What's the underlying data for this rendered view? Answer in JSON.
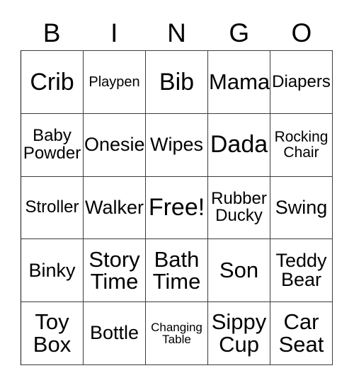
{
  "card": {
    "title": "BINGO",
    "columns": [
      "B",
      "I",
      "N",
      "G",
      "O"
    ],
    "rows": [
      [
        {
          "label": "Crib",
          "size": "xl"
        },
        {
          "label": "Playpen",
          "size": "xxs"
        },
        {
          "label": "Bib",
          "size": "xl"
        },
        {
          "label": "Mama",
          "size": "lg"
        },
        {
          "label": "Diapers",
          "size": "sm"
        }
      ],
      [
        {
          "label": "Baby\nPowder",
          "size": "sm"
        },
        {
          "label": "Onesie",
          "size": "md"
        },
        {
          "label": "Wipes",
          "size": "md"
        },
        {
          "label": "Dada",
          "size": "xl"
        },
        {
          "label": "Rocking\nChair",
          "size": "xs"
        }
      ],
      [
        {
          "label": "Stroller",
          "size": "sm"
        },
        {
          "label": "Walker",
          "size": "md"
        },
        {
          "label": "Free!",
          "size": "xl"
        },
        {
          "label": "Rubber\nDucky",
          "size": "sm"
        },
        {
          "label": "Swing",
          "size": "md"
        }
      ],
      [
        {
          "label": "Binky",
          "size": "md"
        },
        {
          "label": "Story\nTime",
          "size": "lg"
        },
        {
          "label": "Bath\nTime",
          "size": "lg"
        },
        {
          "label": "Son",
          "size": "lg"
        },
        {
          "label": "Teddy\nBear",
          "size": "md"
        }
      ],
      [
        {
          "label": "Toy\nBox",
          "size": "lg"
        },
        {
          "label": "Bottle",
          "size": "md"
        },
        {
          "label": "Changing\nTable",
          "size": "tiny"
        },
        {
          "label": "Sippy\nCup",
          "size": "lg"
        },
        {
          "label": "Car\nSeat",
          "size": "lg"
        }
      ]
    ],
    "free_space": {
      "row": 2,
      "col": 2,
      "label": "Free!"
    },
    "colors": {
      "background": "#ffffff",
      "text": "#000000",
      "border": "#3c3c3c"
    }
  }
}
